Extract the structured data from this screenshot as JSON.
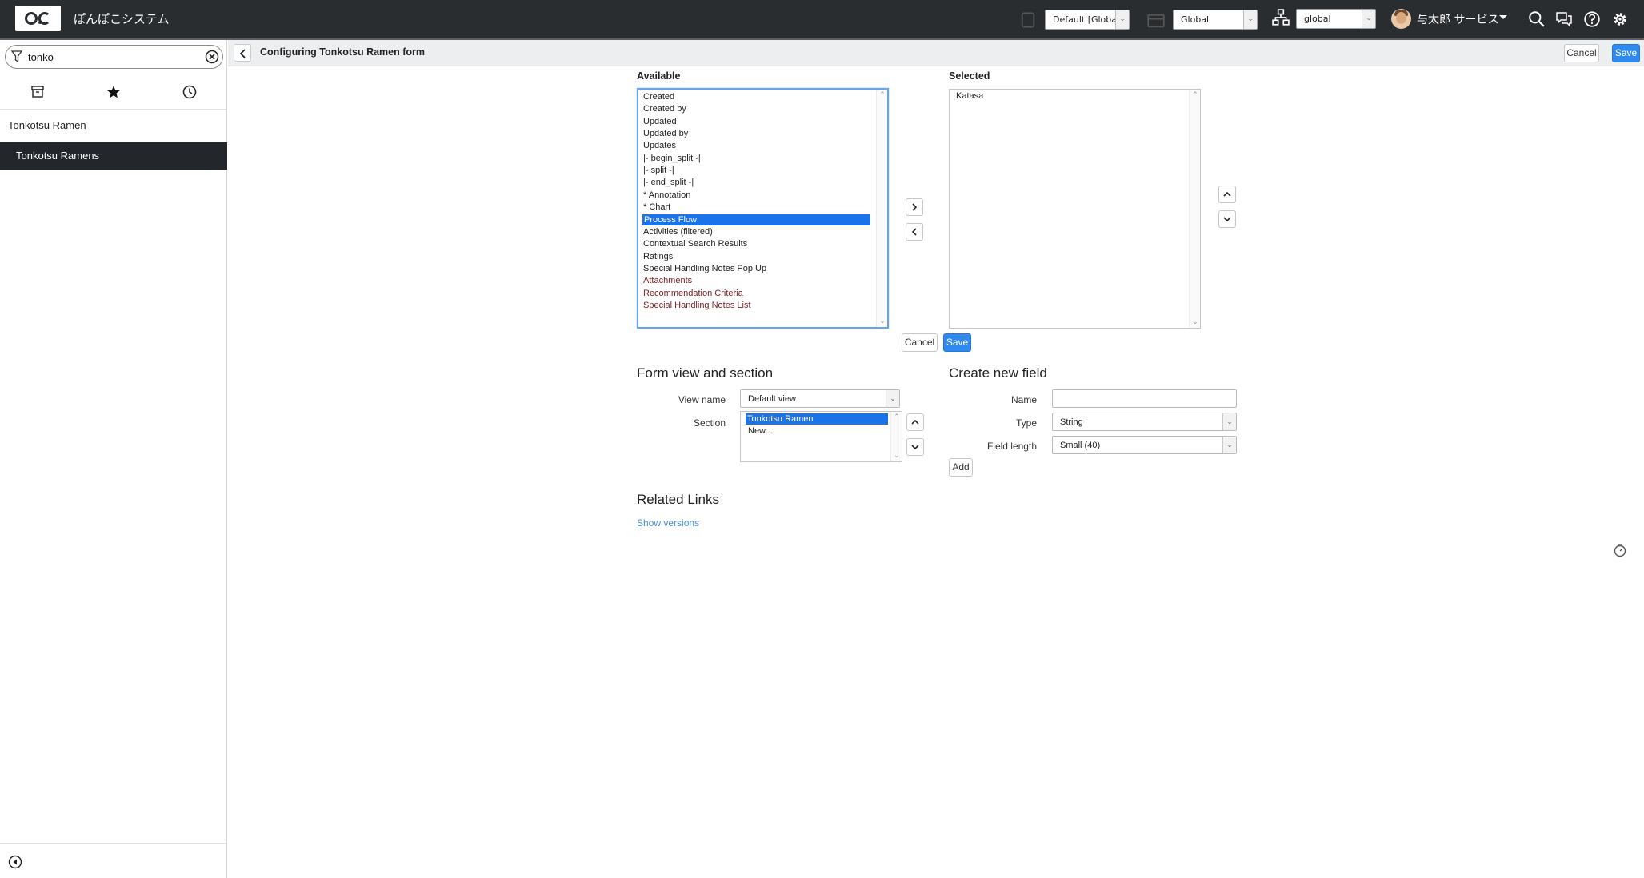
{
  "header": {
    "app_name": "ぽんぽこシステム",
    "update_set": "Default [Globa",
    "application_scope": "Global",
    "domain": "global",
    "user_name": "与太郎 サービス",
    "icons": [
      "update-set-icon",
      "application-icon",
      "domain-tree-icon",
      "search-icon",
      "chat-icon",
      "help-icon",
      "gear-icon"
    ]
  },
  "nav": {
    "filter_value": "tonko",
    "tabs": [
      "all-apps-icon",
      "favorites-star-icon",
      "history-clock-icon"
    ],
    "items": [
      {
        "label": "Tonkotsu Ramen",
        "active": false
      },
      {
        "label": "Tonkotsu Ramens",
        "active": true
      }
    ]
  },
  "form": {
    "title": "Configuring Tonkotsu Ramen form",
    "cancel_label": "Cancel",
    "save_label": "Save"
  },
  "slush": {
    "available_label": "Available",
    "selected_label": "Selected",
    "available": [
      {
        "label": "Created",
        "style": "normal"
      },
      {
        "label": "Created by",
        "style": "normal"
      },
      {
        "label": "Updated",
        "style": "normal"
      },
      {
        "label": "Updated by",
        "style": "normal"
      },
      {
        "label": "Updates",
        "style": "normal"
      },
      {
        "label": "|- begin_split -|",
        "style": "normal"
      },
      {
        "label": "|- split -|",
        "style": "normal"
      },
      {
        "label": "|- end_split -|",
        "style": "normal"
      },
      {
        "label": "* Annotation",
        "style": "normal"
      },
      {
        "label": "* Chart",
        "style": "normal"
      },
      {
        "label": "Process Flow",
        "style": "selected"
      },
      {
        "label": "Activities (filtered)",
        "style": "normal"
      },
      {
        "label": "Contextual Search Results",
        "style": "normal"
      },
      {
        "label": "Ratings",
        "style": "normal"
      },
      {
        "label": "Special Handling Notes Pop Up",
        "style": "normal"
      },
      {
        "label": "Attachments",
        "style": "red"
      },
      {
        "label": "Recommendation Criteria",
        "style": "red"
      },
      {
        "label": "Special Handling Notes List",
        "style": "red"
      }
    ],
    "selected": [
      "Katasa"
    ],
    "cancel_label": "Cancel",
    "save_label": "Save"
  },
  "view_section": {
    "title": "Form view and section",
    "view_name_label": "View name",
    "view_name_value": "Default view",
    "section_label": "Section",
    "sections": [
      {
        "label": "Tonkotsu Ramen",
        "selected": true
      },
      {
        "label": "New...",
        "selected": false
      }
    ]
  },
  "new_field": {
    "title": "Create new field",
    "name_label": "Name",
    "name_value": "",
    "type_label": "Type",
    "type_value": "String",
    "length_label": "Field length",
    "length_value": "Small (40)",
    "add_label": "Add"
  },
  "related": {
    "title": "Related Links",
    "show_versions": "Show versions"
  },
  "colors": {
    "header_bg": "#2a2d30",
    "primary": "#2f8aef",
    "selection": "#1a73e8",
    "nav_active": "#23262a",
    "red_option": "#7a1f1f"
  }
}
